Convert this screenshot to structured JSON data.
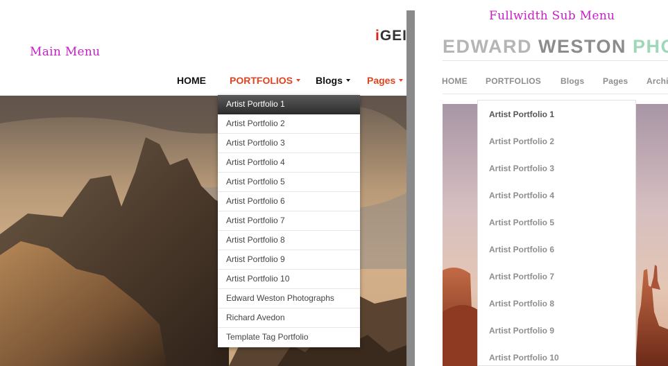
{
  "annotations": {
    "main_menu": "Main Menu",
    "fullwidth_sub_menu": "Fullwidth Sub Menu"
  },
  "left": {
    "logo_fragment_i": "i",
    "logo_fragment_rest": "GEI",
    "nav": [
      {
        "label": "HOME"
      },
      {
        "label": "PORTFOLIOS"
      },
      {
        "label": "Blogs"
      },
      {
        "label": "Pages"
      }
    ],
    "dropdown": [
      "Artist Portfolio 1",
      "Artist Portfolio 2",
      "Artist Portfolio 3",
      "Artist Portfolio 4",
      "Artist Portfolio 5",
      "Artist Portfolio 6",
      "Artist Portfolio 7",
      "Artist Portfolio 8",
      "Artist Portfolio 9",
      "Artist Portfolio 10",
      "Edward Weston Photographs",
      "Richard Avedon",
      "Template Tag Portfolio"
    ]
  },
  "right": {
    "brand_part1": "EDWARD",
    "brand_part2": "WESTON",
    "brand_part3": "PHO",
    "nav": [
      {
        "label": "HOME"
      },
      {
        "label": "PORTFOLIOS"
      },
      {
        "label": "Blogs"
      },
      {
        "label": "Pages"
      },
      {
        "label": "Archi"
      }
    ],
    "submenu": [
      "Artist Portfolio 1",
      "Artist Portfolio 2",
      "Artist Portfolio 3",
      "Artist Portfolio 4",
      "Artist Portfolio 5",
      "Artist Portfolio 6",
      "Artist Portfolio 7",
      "Artist Portfolio 8",
      "Artist Portfolio 9",
      "Artist Portfolio 10"
    ]
  },
  "colors": {
    "annotation": "#c81ec8",
    "accent_orange": "#e0441e",
    "brand_green": "#9fd8b8",
    "divider": "#8a8a8a"
  }
}
